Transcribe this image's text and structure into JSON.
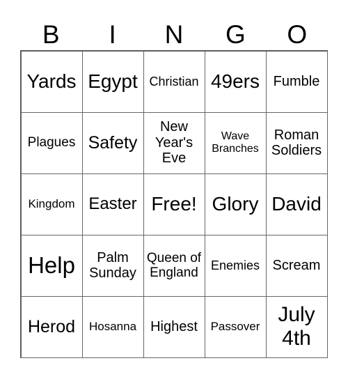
{
  "header": [
    "B",
    "I",
    "N",
    "G",
    "O"
  ],
  "cells": [
    [
      "Yards",
      "Egypt",
      "Christian",
      "49ers",
      "Fumble"
    ],
    [
      "Plagues",
      "Safety",
      "New Year's Eve",
      "Wave Branches",
      "Roman Soldiers"
    ],
    [
      "Kingdom",
      "Easter",
      "Free!",
      "Glory",
      "David"
    ],
    [
      "Help",
      "Palm Sunday",
      "Queen of England",
      "Enemies",
      "Scream"
    ],
    [
      "Herod",
      "Hosanna",
      "Highest",
      "Passover",
      "July 4th"
    ]
  ]
}
